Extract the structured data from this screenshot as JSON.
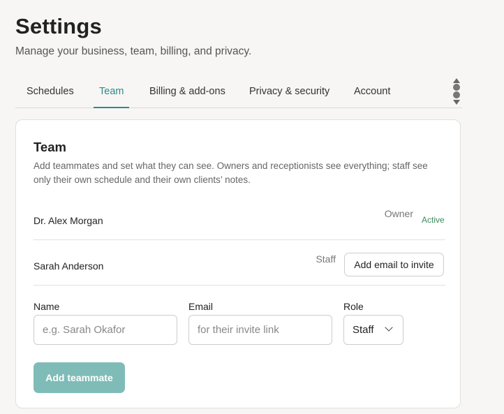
{
  "page": {
    "title": "Settings",
    "subtitle": "Manage your business, team, billing, and privacy."
  },
  "tabs": [
    {
      "label": "Schedules",
      "active": false
    },
    {
      "label": "Team",
      "active": true
    },
    {
      "label": "Billing & add-ons",
      "active": false
    },
    {
      "label": "Privacy & security",
      "active": false
    },
    {
      "label": "Account",
      "active": false
    }
  ],
  "team_card": {
    "title": "Team",
    "description": "Add teammates and set what they can see. Owners and receptionists see everything; staff see only their own schedule and their own clients’ notes.",
    "members": [
      {
        "name": "Dr. Alex Morgan",
        "role": "Owner",
        "status": "Active"
      },
      {
        "name": "Sarah Anderson",
        "role": "Staff",
        "action_label": "Add email to invite"
      }
    ],
    "form": {
      "name_label": "Name",
      "name_placeholder": "e.g. Sarah Okafor",
      "name_value": "",
      "email_label": "Email",
      "email_placeholder": "for their invite link",
      "email_value": "",
      "role_label": "Role",
      "role_value": "Staff",
      "submit_label": "Add teammate"
    }
  },
  "colors": {
    "accent": "#2d8a87",
    "button_disabled": "#7fbcb8",
    "status_active": "#3b8a5a"
  }
}
